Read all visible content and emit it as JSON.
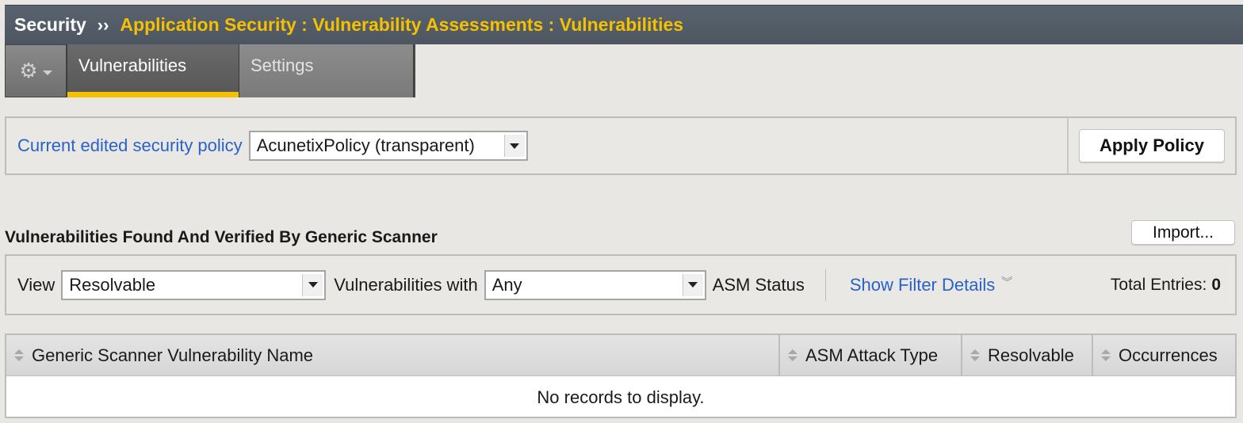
{
  "header": {
    "section": "Security",
    "separator": "››",
    "path": "Application Security : Vulnerability Assessments : Vulnerabilities"
  },
  "tabs": {
    "active": "Vulnerabilities",
    "inactive": "Settings"
  },
  "policy": {
    "label": "Current edited security policy",
    "selected": "AcunetixPolicy (transparent)",
    "apply_label": "Apply Policy"
  },
  "section": {
    "title": "Vulnerabilities Found And Verified By Generic Scanner",
    "import_label": "Import..."
  },
  "filter": {
    "view_label": "View",
    "view_value": "Resolvable",
    "vulnerabilities_with_label": "Vulnerabilities with",
    "vulnerabilities_with_value": "Any",
    "asm_status_label": "ASM Status",
    "show_filter_label": "Show Filter Details",
    "total_label": "Total Entries:",
    "total_value": "0"
  },
  "table": {
    "columns": [
      "Generic Scanner Vulnerability Name",
      "ASM Attack Type",
      "Resolvable",
      "Occurrences"
    ],
    "empty_message": "No records to display."
  },
  "colors": {
    "header_bg": "#525c67",
    "accent_yellow": "#f5c000",
    "link_blue": "#2a62c9",
    "page_bg": "#e8e7e3"
  },
  "icons": {
    "gear": "gear-icon",
    "dropdown": "chevron-down-icon",
    "sort": "sort-icon",
    "expand": "double-chevron-down-icon"
  }
}
